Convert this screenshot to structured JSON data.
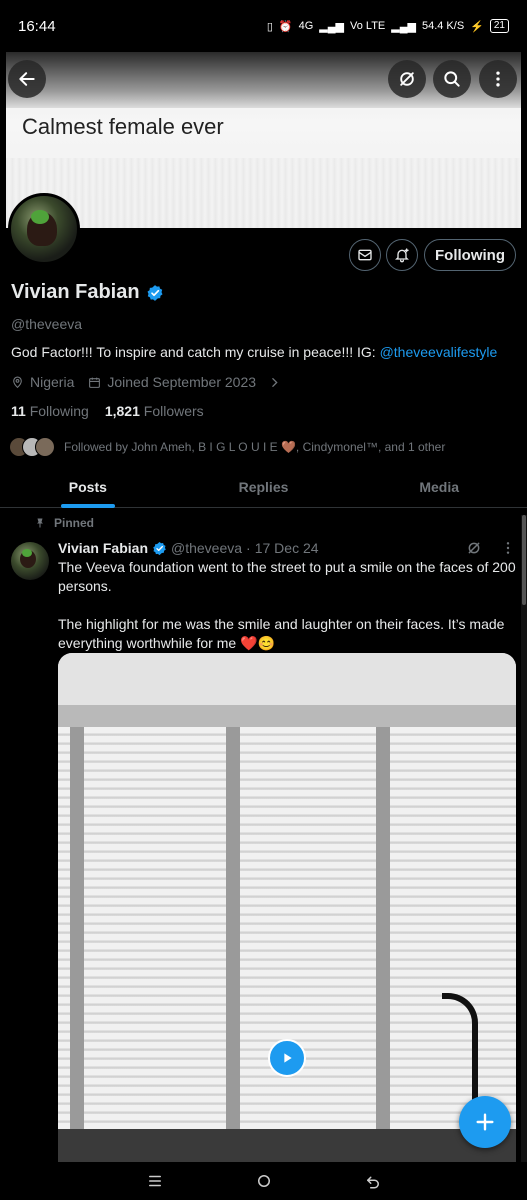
{
  "status_bar": {
    "time": "16:44",
    "network_1": "4G",
    "network_2": "Vo LTE",
    "speed": "54.4 K/S",
    "battery": "21"
  },
  "banner": {
    "text": "Calmest female ever"
  },
  "top_actions": {
    "back_icon": "arrow-left-icon",
    "grok_icon": "slash-circle-icon",
    "search_icon": "search-icon",
    "more_icon": "more-vertical-icon"
  },
  "profile": {
    "display_name": "Vivian Fabian",
    "handle": "@theveeva",
    "bio_text": "God Factor!!! To inspire and catch my cruise in peace!!! IG: ",
    "bio_link": "@theveevalifestyle",
    "location": "Nigeria",
    "joined": "Joined September 2023",
    "following_count": "11",
    "following_label": "Following",
    "followers_count": "1,821",
    "followers_label": "Followers",
    "followed_by": "Followed by John Ameh, B I G L O U I E 🤎, Cindymonel™, and 1 other",
    "follow_button": "Following"
  },
  "tabs": [
    {
      "label": "Posts",
      "active": true
    },
    {
      "label": "Replies",
      "active": false
    },
    {
      "label": "Media",
      "active": false
    }
  ],
  "pinned_tweet": {
    "pinned_label": "Pinned",
    "name": "Vivian Fabian",
    "handle": "@theveeva",
    "dot": "·",
    "date": "17 Dec 24",
    "paragraph_1": "The Veeva foundation went to the street to put a smile on the faces of 200 persons.",
    "paragraph_2": "The highlight for me was the smile and laughter on their faces. It’s made everything worthwhile for me ❤️😊"
  },
  "colors": {
    "accent": "#1d9bf0",
    "background": "#000000",
    "secondary_text": "#71767b"
  }
}
